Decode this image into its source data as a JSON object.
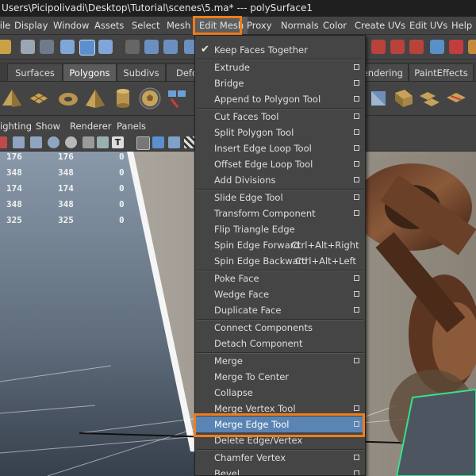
{
  "window": {
    "title": "Users\\Picipolivadi\\Desktop\\Tutorial\\scenes\\5.ma*   ---   polySurface1"
  },
  "menubar": {
    "items": [
      "File",
      "Display",
      "Window",
      "Assets",
      "Select",
      "Mesh",
      "Edit Mesh",
      "Proxy",
      "Normals",
      "Color",
      "Create UVs",
      "Edit UVs",
      "Help"
    ],
    "active": "Edit Mesh"
  },
  "shelf_tabs": {
    "items": [
      "Surfaces",
      "Polygons",
      "Subdivs",
      "Defo",
      "endering",
      "PaintEffects"
    ],
    "active": "Polygons"
  },
  "panel_menu": {
    "items": [
      "ighting",
      "Show",
      "Renderer",
      "Panels"
    ]
  },
  "hud": {
    "rows": [
      [
        "176",
        "176",
        "0"
      ],
      [
        "348",
        "348",
        "0"
      ],
      [
        "174",
        "174",
        "0"
      ],
      [
        "348",
        "348",
        "0"
      ],
      [
        "325",
        "325",
        "0"
      ]
    ]
  },
  "edit_mesh_menu": {
    "items": [
      {
        "label": "Keep Faces Together",
        "checked": true,
        "option": false
      },
      {
        "label": "Extrude",
        "option": true
      },
      {
        "label": "Bridge",
        "option": true
      },
      {
        "label": "Append to Polygon Tool",
        "option": true
      },
      {
        "label": "Cut Faces Tool",
        "option": true
      },
      {
        "label": "Split Polygon Tool",
        "option": true
      },
      {
        "label": "Insert Edge Loop Tool",
        "option": true
      },
      {
        "label": "Offset Edge Loop Tool",
        "option": true
      },
      {
        "label": "Add Divisions",
        "option": true
      },
      {
        "label": "Slide Edge Tool",
        "option": true
      },
      {
        "label": "Transform Component",
        "option": true
      },
      {
        "label": "Flip Triangle Edge",
        "option": false
      },
      {
        "label": "Spin Edge Forward",
        "shortcut": "Ctrl+Alt+Right",
        "option": false
      },
      {
        "label": "Spin Edge Backward",
        "shortcut": "Ctrl+Alt+Left",
        "option": false
      },
      {
        "label": "Poke Face",
        "option": true
      },
      {
        "label": "Wedge Face",
        "option": true
      },
      {
        "label": "Duplicate Face",
        "option": true
      },
      {
        "label": "Connect Components",
        "option": false
      },
      {
        "label": "Detach Component",
        "option": false
      },
      {
        "label": "Merge",
        "option": true
      },
      {
        "label": "Merge To Center",
        "option": false
      },
      {
        "label": "Collapse",
        "option": false
      },
      {
        "label": "Merge Vertex Tool",
        "option": true
      },
      {
        "label": "Merge Edge Tool",
        "option": true,
        "highlighted": true
      },
      {
        "label": "Delete Edge/Vertex",
        "option": false
      },
      {
        "label": "Chamfer Vertex",
        "option": true
      },
      {
        "label": "Bevel",
        "option": true
      }
    ]
  },
  "colors": {
    "highlight": "#f07d1c",
    "menu_highlight": "#5a84b3",
    "menu_bg": "#454545",
    "selection_wire": "#37e08a"
  }
}
